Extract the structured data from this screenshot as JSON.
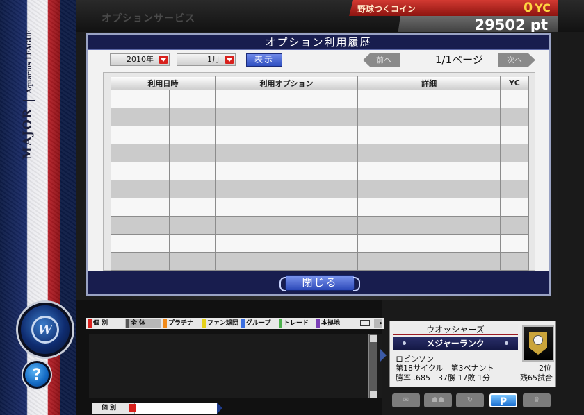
{
  "header": {
    "page_caption": "オプションサービス",
    "coin_label": "野球つくコイン",
    "coin_value": "0",
    "coin_unit": "YC",
    "points": "29502 pt"
  },
  "league": {
    "major": "MAJOR",
    "sub": "Aquarius LEAGUE"
  },
  "modal": {
    "title": "オプション利用履歴",
    "year": "2010年",
    "month": "1月",
    "show_label": "表示",
    "prev_label": "前へ",
    "next_label": "次へ",
    "page_indicator": "1/1ページ",
    "columns": [
      "利用日時",
      "",
      "利用オプション",
      "詳細",
      "YC"
    ],
    "close_label": "閉じる"
  },
  "chat": {
    "tabs": [
      {
        "label": "個 別",
        "color": "#d8201c"
      },
      {
        "label": "全 体",
        "color": "#555555"
      },
      {
        "label": "プラチナ",
        "color": "#f08a1a"
      },
      {
        "label": "ファン球団",
        "color": "#e6d21a"
      },
      {
        "label": "グループ",
        "color": "#3b6fe0"
      },
      {
        "label": "トレード",
        "color": "#4bb04b"
      },
      {
        "label": "本拠地",
        "color": "#7b3fb6"
      }
    ],
    "channel": "個 別",
    "input_value": ""
  },
  "team": {
    "name": "ウオッシャーズ",
    "rank": "メジャーランク",
    "manager": "ロビンソン",
    "season": "第18サイクル　第3ペナント",
    "position": "2位",
    "record": "勝率 .685　37勝 17敗 1分",
    "games_left": "残65試合"
  },
  "icon_strip": {
    "p_label": "P"
  }
}
